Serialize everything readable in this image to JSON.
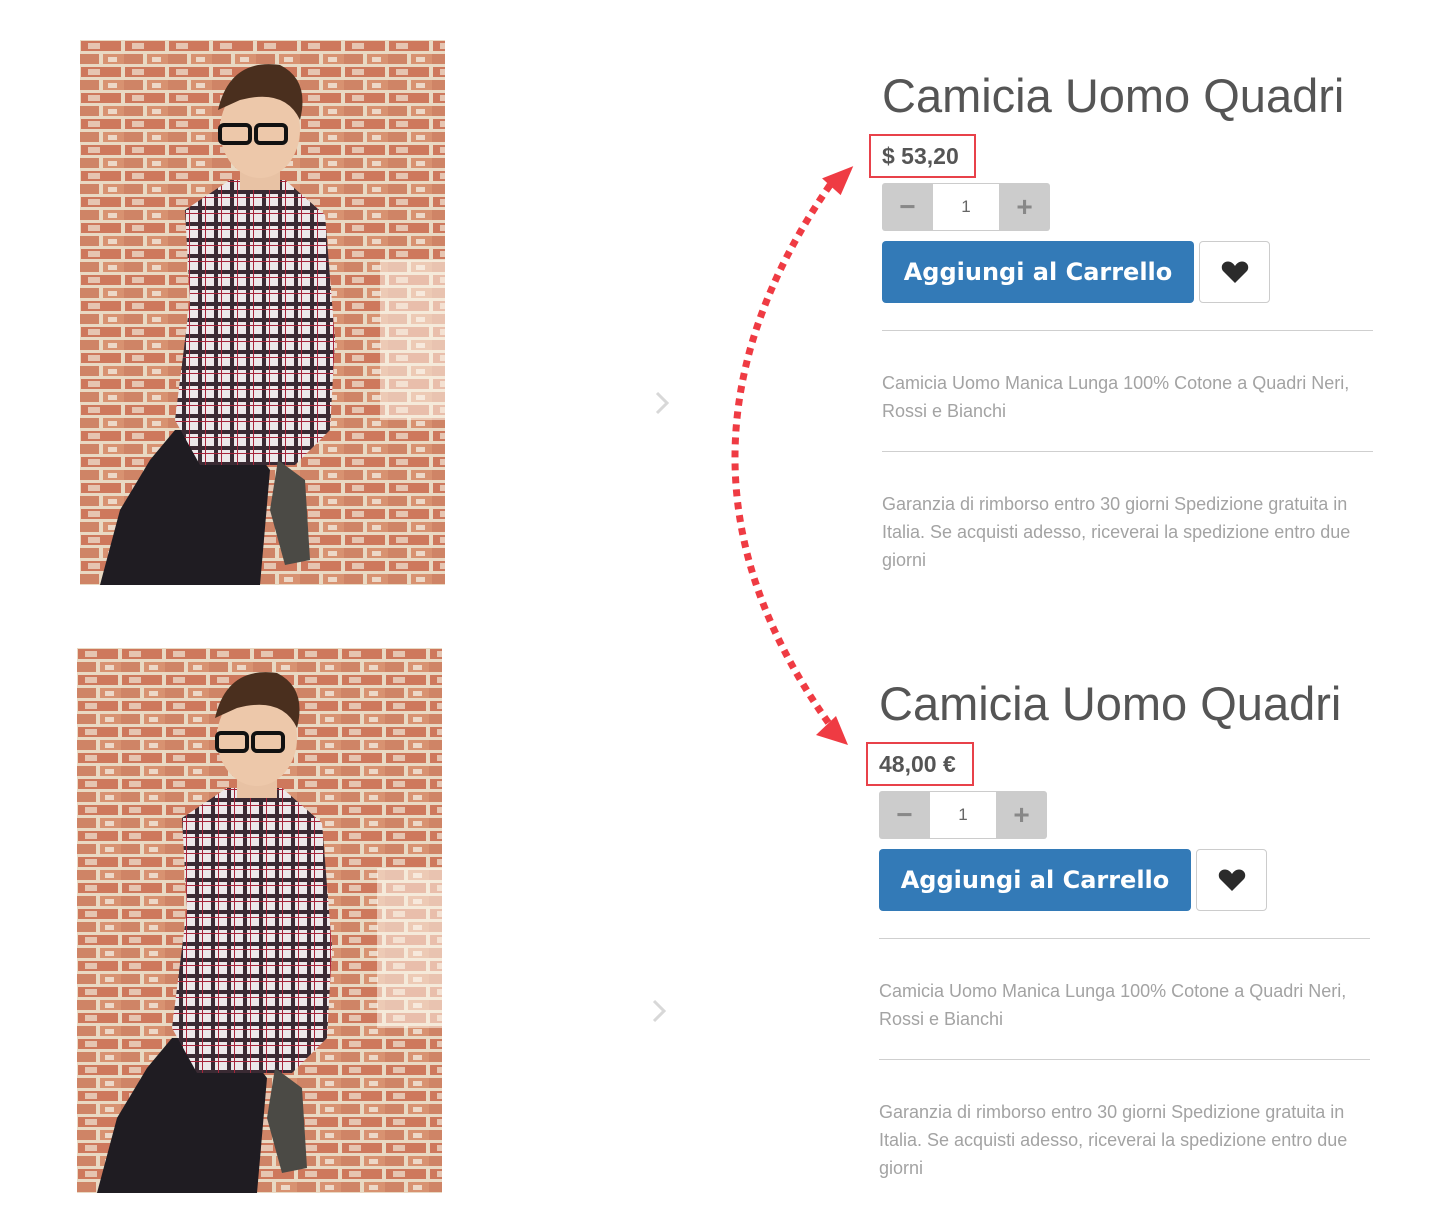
{
  "colors": {
    "accent": "#337ab7",
    "highlight": "#e8414a",
    "text": "#555555",
    "muted": "#a3a3a3"
  },
  "products": [
    {
      "title": "Camicia Uomo Quadri",
      "price": "$ 53,20",
      "quantity": "1",
      "minus_label": "−",
      "plus_label": "+",
      "cart_label": "Aggiungi al Carrello",
      "wishlist_icon": "heart-icon",
      "description": "Camicia Uomo Manica Lunga 100% Cotone a Quadri Neri, Rossi e Bianchi",
      "guarantee": "Garanzia di rimborso entro 30 giorni Spedizione gratuita in Italia. Se acquisti adesso, riceverai la spedizione entro due giorni"
    },
    {
      "title": "Camicia Uomo Quadri",
      "price": "48,00 €",
      "quantity": "1",
      "minus_label": "−",
      "plus_label": "+",
      "cart_label": "Aggiungi al Carrello",
      "wishlist_icon": "heart-icon",
      "description": "Camicia Uomo Manica Lunga 100% Cotone a Quadri Neri, Rossi e Bianchi",
      "guarantee": "Garanzia di rimborso entro 30 giorni Spedizione gratuita in Italia. Se acquisti adesso, riceverai la spedizione entro due giorni"
    }
  ]
}
